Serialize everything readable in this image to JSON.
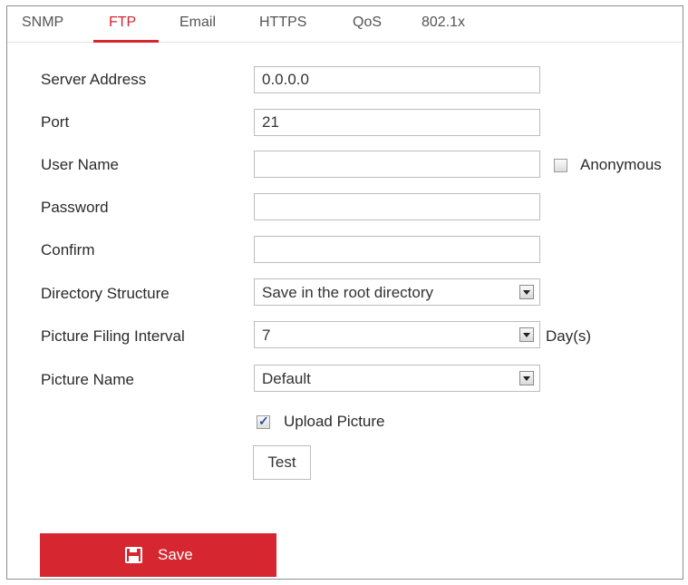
{
  "tabs": {
    "snmp": "SNMP",
    "ftp": "FTP",
    "email": "Email",
    "https": "HTTPS",
    "qos": "QoS",
    "dot1x": "802.1x",
    "active": "FTP"
  },
  "form": {
    "server_address": {
      "label": "Server Address",
      "value": "0.0.0.0"
    },
    "port": {
      "label": "Port",
      "value": "21"
    },
    "user_name": {
      "label": "User Name",
      "value": ""
    },
    "anonymous": {
      "label": "Anonymous",
      "checked": false
    },
    "password": {
      "label": "Password",
      "value": ""
    },
    "confirm": {
      "label": "Confirm",
      "value": ""
    },
    "directory_structure": {
      "label": "Directory Structure",
      "value": "Save in the root directory"
    },
    "picture_filing_interval": {
      "label": "Picture Filing Interval",
      "value": "7",
      "unit": "Day(s)"
    },
    "picture_name": {
      "label": "Picture Name",
      "value": "Default"
    },
    "upload_picture": {
      "label": "Upload Picture",
      "checked": true
    },
    "test_label": "Test"
  },
  "save": {
    "label": "Save"
  },
  "colors": {
    "accent": "#d6262f",
    "border": "#8f8f8f"
  },
  "icons": {
    "save": "floppy-disk-icon",
    "dropdown": "chevron-down-icon"
  }
}
